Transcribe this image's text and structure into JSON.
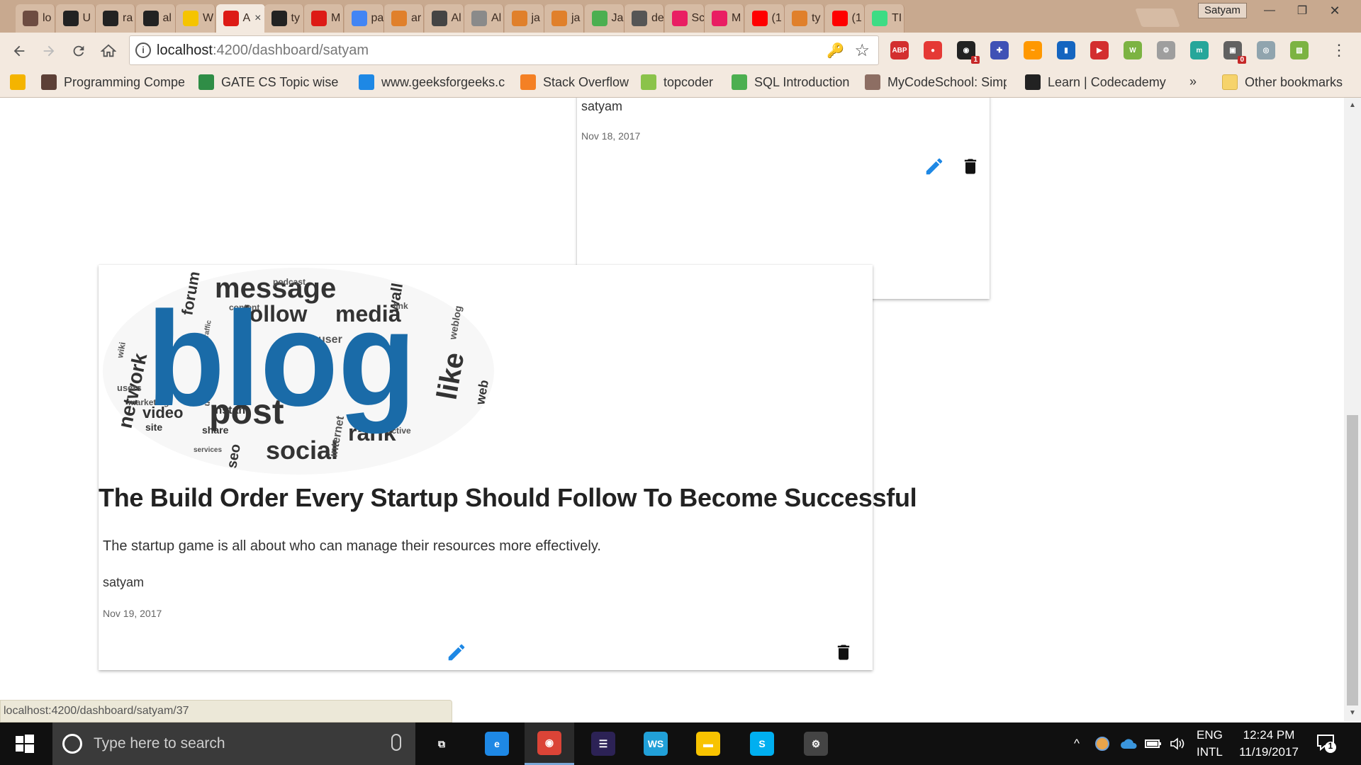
{
  "window": {
    "profile_name": "Satyam",
    "minimize": "—",
    "restore": "❐",
    "close": "✕"
  },
  "tabs": [
    {
      "label": "lo",
      "icon": "ithink-icon",
      "color": "#6d4c41"
    },
    {
      "label": "U",
      "icon": "github-icon",
      "color": "#222222"
    },
    {
      "label": "ra",
      "icon": "github-icon",
      "color": "#222222"
    },
    {
      "label": "al",
      "icon": "github-icon",
      "color": "#222222"
    },
    {
      "label": "W",
      "icon": "ih-icon",
      "color": "#f5c400"
    },
    {
      "label": "A",
      "icon": "angular-icon",
      "color": "#dd1b16",
      "active": true
    },
    {
      "label": "ty",
      "icon": "github-icon",
      "color": "#222222"
    },
    {
      "label": "M",
      "icon": "angular-icon",
      "color": "#dd1b16"
    },
    {
      "label": "pa",
      "icon": "google-icon",
      "color": "#4285f4"
    },
    {
      "label": "ar",
      "icon": "hackerearth-icon",
      "color": "#e0802b"
    },
    {
      "label": "Al",
      "icon": "spy-icon",
      "color": "#444444"
    },
    {
      "label": "Al",
      "icon": "lines-icon",
      "color": "#8a8a8a"
    },
    {
      "label": "ja",
      "icon": "hackerearth-icon",
      "color": "#e0802b"
    },
    {
      "label": "ja",
      "icon": "hackerearth-icon",
      "color": "#e0802b"
    },
    {
      "label": "Ja",
      "icon": "w3-icon",
      "color": "#4caf50"
    },
    {
      "label": "de",
      "icon": "cloud-icon",
      "color": "#555555"
    },
    {
      "label": "Sc",
      "icon": "play-pink-icon",
      "color": "#e91e63"
    },
    {
      "label": "M",
      "icon": "play-pink-icon",
      "color": "#e91e63"
    },
    {
      "label": "(1",
      "icon": "youtube-icon",
      "color": "#ff0000"
    },
    {
      "label": "ty",
      "icon": "hackerearth-icon",
      "color": "#e0802b"
    },
    {
      "label": "(1",
      "icon": "youtube-icon",
      "color": "#ff0000"
    },
    {
      "label": "TI",
      "icon": "android-icon",
      "color": "#3ddc84"
    }
  ],
  "tab_close_glyph": "×",
  "toolbar": {
    "url_host": "localhost",
    "url_path": ":4200/dashboard/satyam",
    "info_glyph": "i",
    "key_glyph": "🔑",
    "star_glyph": "☆",
    "menu_glyph": "⋮"
  },
  "extensions": [
    {
      "name": "adblock-icon",
      "label": "ABP",
      "color": "#d32f2f"
    },
    {
      "name": "shield-icon",
      "label": "●",
      "color": "#e53935"
    },
    {
      "name": "ghost-icon",
      "label": "◉",
      "color": "#222222",
      "badge": "1"
    },
    {
      "name": "puzzle-icon",
      "label": "✚",
      "color": "#3f51b5"
    },
    {
      "name": "wave-icon",
      "label": "~",
      "color": "#ff9800"
    },
    {
      "name": "bookmark-icon",
      "label": "▮",
      "color": "#1565c0"
    },
    {
      "name": "pocket-icon",
      "label": "▶",
      "color": "#d32f2f"
    },
    {
      "name": "grammar-icon",
      "label": "W",
      "color": "#7cb342"
    },
    {
      "name": "gear-ext-icon",
      "label": "⚙",
      "color": "#9e9e9e"
    },
    {
      "name": "m-icon",
      "label": "m",
      "color": "#26a69a"
    },
    {
      "name": "briefcase-icon",
      "label": "▣",
      "color": "#616161",
      "badge": "0"
    },
    {
      "name": "eye-icon",
      "label": "◎",
      "color": "#90a4ae"
    },
    {
      "name": "screenshot-icon",
      "label": "▧",
      "color": "#7cb342"
    }
  ],
  "bookmarks": [
    {
      "label": "",
      "icon": "google-drive-icon",
      "color": "#f4b400"
    },
    {
      "label": "Programming Compe",
      "icon": "cc-icon",
      "color": "#5d4037"
    },
    {
      "label": "GATE CS Topic wise p",
      "icon": "gfg-icon",
      "color": "#2f8d46"
    },
    {
      "label": "www.geeksforgeeks.c",
      "icon": "t-icon",
      "color": "#1e88e5"
    },
    {
      "label": "Stack Overflow",
      "icon": "stackoverflow-icon",
      "color": "#f48024"
    },
    {
      "label": "topcoder",
      "icon": "topcoder-icon",
      "color": "#8bc34a"
    },
    {
      "label": "SQL Introduction",
      "icon": "w3-bm-icon",
      "color": "#4caf50"
    },
    {
      "label": "MyCodeSchool: Simp",
      "icon": "mycodeschool-icon",
      "color": "#8d6e63"
    },
    {
      "label": "Learn | Codecademy",
      "icon": "codecademy-icon",
      "color": "#222222"
    }
  ],
  "bookmarks_more": "»",
  "other_bookmarks": "Other bookmarks",
  "cards": {
    "previous": {
      "author": "satyam",
      "date": "Nov 18, 2017"
    },
    "current": {
      "title": "The Build Order Every Startup Should Follow To Become Successful",
      "description": "The startup game is all about who can manage their resources more effectively.",
      "author": "satyam",
      "date": "Nov 19, 2017"
    }
  },
  "word_cloud": {
    "main": "blog",
    "words": [
      "message",
      "follow",
      "media",
      "post",
      "social",
      "rank",
      "network",
      "like",
      "video",
      "site",
      "share",
      "instant",
      "seo",
      "forum",
      "user",
      "weblog",
      "wall",
      "link",
      "podcast",
      "content",
      "internet",
      "marketing",
      "services",
      "users",
      "effective",
      "traffic",
      "wiki",
      "web",
      "use"
    ]
  },
  "status_url": "localhost:4200/dashboard/satyam/37",
  "taskbar": {
    "search_placeholder": "Type here to search",
    "apps": [
      {
        "name": "task-view-icon",
        "label": "⧉",
        "color": "transparent"
      },
      {
        "name": "edge-icon",
        "label": "e",
        "color": "#1e88e5"
      },
      {
        "name": "chrome-icon",
        "label": "◉",
        "color": "#db4437",
        "active": true
      },
      {
        "name": "eclipse-icon",
        "label": "☰",
        "color": "#2c2255"
      },
      {
        "name": "webstorm-icon",
        "label": "WS",
        "color": "#21a0d8"
      },
      {
        "name": "file-explorer-icon",
        "label": "▬",
        "color": "#f8c300"
      },
      {
        "name": "skype-icon",
        "label": "S",
        "color": "#00aff0"
      },
      {
        "name": "settings-gear-icon",
        "label": "⚙",
        "color": "#444444"
      }
    ],
    "lang_top": "ENG",
    "lang_bottom": "INTL",
    "time": "12:24 PM",
    "date": "11/19/2017",
    "notification_count": "1",
    "tray_up": "^"
  },
  "colors": {
    "accent_blue": "#1e88e5",
    "blog_blue": "#1a6ba8",
    "tab_bg": "#c8a98f",
    "toolbar_bg": "#f3e9df"
  }
}
